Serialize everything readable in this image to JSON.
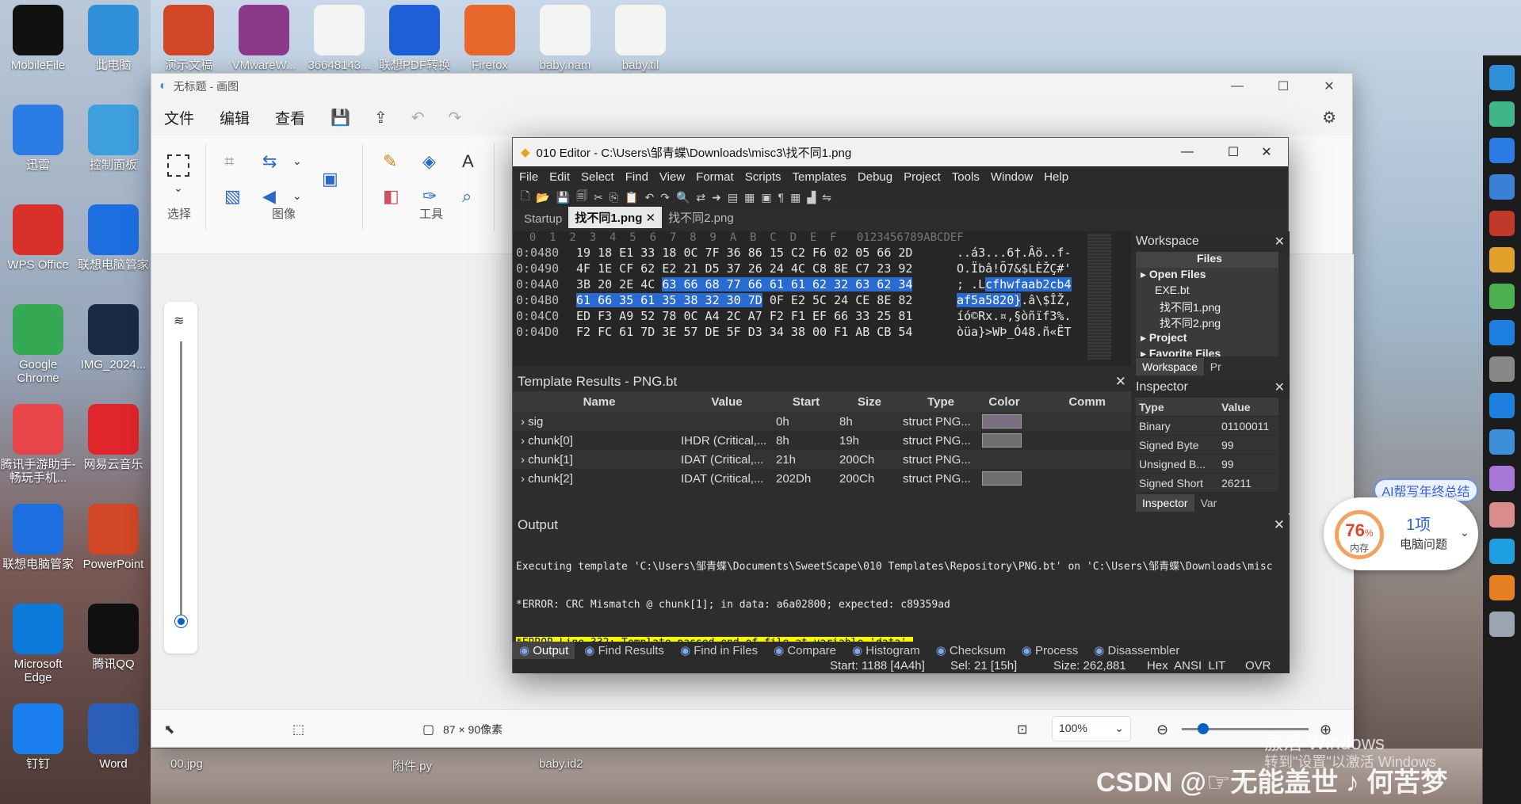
{
  "desktop": {
    "icons": [
      {
        "label": "MobileFile",
        "icon": "mobilefile-icon",
        "color": "#111111"
      },
      {
        "label": "此电脑",
        "icon": "computer-icon",
        "color": "#2f8fd8"
      },
      {
        "label": "演示文稿",
        "icon": "powerpoint-file-icon",
        "color": "#d24726"
      },
      {
        "label": "VMwareW...",
        "icon": "winrar-icon",
        "color": "#8b3a8b"
      },
      {
        "label": "36648143...",
        "icon": "document-icon",
        "color": "#f4f4f4"
      },
      {
        "label": "联想PDF转换",
        "icon": "pdf-icon",
        "color": "#1d5fd6"
      },
      {
        "label": "Firefox",
        "icon": "firefox-icon",
        "color": "#e8672a"
      },
      {
        "label": "baby.nam",
        "icon": "file-icon",
        "color": "#f4f4f4"
      },
      {
        "label": "baby.til",
        "icon": "file-icon",
        "color": "#f4f4f4"
      },
      {
        "label": "迅雷",
        "icon": "xunlei-icon",
        "color": "#2a7be4"
      },
      {
        "label": "控制面板",
        "icon": "control-panel-icon",
        "color": "#3fa0e0"
      },
      {
        "label": "WPS Office",
        "icon": "wps-icon",
        "color": "#d9302c"
      },
      {
        "label": "联想电脑管家",
        "icon": "lenovo-manager-icon",
        "color": "#1d6fe0"
      },
      {
        "label": "Google Chrome",
        "icon": "chrome-icon",
        "color": "#34a853"
      },
      {
        "label": "IMG_2024...",
        "icon": "image-icon",
        "color": "#1b2a44"
      },
      {
        "label": "腾讯手游助手-畅玩手机...",
        "icon": "tencent-game-icon",
        "color": "#e8454a"
      },
      {
        "label": "网易云音乐",
        "icon": "netease-music-icon",
        "color": "#e0262b"
      },
      {
        "label": "联想电脑管家",
        "icon": "lenovo-manager-icon",
        "color": "#1d6fe0"
      },
      {
        "label": "PowerPoint",
        "icon": "powerpoint-icon",
        "color": "#d24726"
      },
      {
        "label": "Microsoft Edge",
        "icon": "edge-icon",
        "color": "#0c7ad8"
      },
      {
        "label": "腾讯QQ",
        "icon": "qq-icon",
        "color": "#111111"
      },
      {
        "label": "钉钉",
        "icon": "dingtalk-icon",
        "color": "#1a7ef0"
      },
      {
        "label": "Word",
        "icon": "word-icon",
        "color": "#2b5fb8"
      }
    ],
    "bottom_labels": [
      "00.jpg",
      "附件.py",
      "baby.id2"
    ]
  },
  "paint": {
    "title": "无标题 - 画图",
    "menu": [
      "文件",
      "编辑",
      "查看"
    ],
    "groups": {
      "select": "选择",
      "image": "图像",
      "tools": "工具"
    },
    "status": {
      "size": "87 × 90像素",
      "zoom": "100%"
    }
  },
  "editor": {
    "title": "010 Editor - C:\\Users\\邹青蝶\\Downloads\\misc3\\找不同1.png",
    "menu": [
      "File",
      "Edit",
      "Select",
      "Find",
      "View",
      "Format",
      "Scripts",
      "Templates",
      "Debug",
      "Project",
      "Tools",
      "Window",
      "Help"
    ],
    "tabs": [
      "Startup",
      "找不同1.png",
      "找不同2.png"
    ],
    "hex_header": "  0  1  2  3  4  5  6  7  8  9  A  B  C  D  E  F   0123456789ABCDEF",
    "hex_rows": [
      {
        "addr": "0:0480",
        "pre": "19 18 E1 33 18 0C 7F 36 86 15 C2 F6 02 05 66 2D",
        "hl": "",
        "post": "",
        "asc_pre": "..á3...6†.Âö..f-",
        "asc_hl": "",
        "asc_post": ""
      },
      {
        "addr": "0:0490",
        "pre": "4F 1E CF 62 E2 21 D5 37 26 24 4C C8 8E C7 23 92",
        "hl": "",
        "post": "",
        "asc_pre": "O.Ïbâ!Õ7&$LÈŽÇ#'",
        "asc_hl": "",
        "asc_post": ""
      },
      {
        "addr": "0:04A0",
        "pre": "3B 20 2E 4C ",
        "hl": "63 66 68 77 66 61 61 62 32 63 62 34",
        "post": "",
        "asc_pre": "; .L",
        "asc_hl": "cfhwfaab2cb4",
        "asc_post": ""
      },
      {
        "addr": "0:04B0",
        "pre": "",
        "hl": "61 66 35 61 35 38 32 30 7D",
        "post": " 0F E2 5C 24 CE 8E 82",
        "asc_pre": "",
        "asc_hl": "af5a5820}",
        "asc_post": ".â\\$ÎŽ‚"
      },
      {
        "addr": "0:04C0",
        "pre": "ED F3 A9 52 78 0C A4 2C A7 F2 F1 EF 66 33 25 81",
        "hl": "",
        "post": "",
        "asc_pre": "íó©Rx.¤,§òñïf3%.",
        "asc_hl": "",
        "asc_post": ""
      },
      {
        "addr": "0:04D0",
        "pre": "F2 FC 61 7D 3E 57 DE 5F D3 34 38 00 F1 AB CB 54",
        "hl": "",
        "post": "",
        "asc_pre": "òüa}>WÞ_Ó48.ñ«ËT",
        "asc_hl": "",
        "asc_post": ""
      }
    ],
    "workspace": {
      "title": "Workspace",
      "files_header": "Files",
      "items": [
        "Open Files",
        "EXE.bt",
        "找不同1.png",
        "找不同2.png",
        "Project",
        "Favorite Files"
      ],
      "tabs": [
        "Workspace",
        "Pr"
      ]
    },
    "inspector": {
      "title": "Inspector",
      "headers": [
        "Type",
        "Value"
      ],
      "rows": [
        {
          "type": "Binary",
          "value": "01100011"
        },
        {
          "type": "Signed Byte",
          "value": "99"
        },
        {
          "type": "Unsigned B...",
          "value": "99"
        },
        {
          "type": "Signed Short",
          "value": "26211"
        }
      ],
      "tabs": [
        "Inspector",
        "Var"
      ]
    },
    "template": {
      "title": "Template Results - PNG.bt",
      "columns": [
        "Name",
        "Value",
        "Start",
        "Size",
        "Type",
        "Color",
        "Comm"
      ],
      "rows": [
        {
          "name": "sig",
          "value": "",
          "start": "0h",
          "size": "8h",
          "type": "struct PNG...",
          "color": "#7a6f7e"
        },
        {
          "name": "chunk[0]",
          "value": "IHDR  (Critical,...",
          "start": "8h",
          "size": "19h",
          "type": "struct PNG...",
          "color": "#6f6f70"
        },
        {
          "name": "chunk[1]",
          "value": "IDAT  (Critical,...",
          "start": "21h",
          "size": "200Ch",
          "type": "struct PNG...",
          "color": ""
        },
        {
          "name": "chunk[2]",
          "value": "IDAT  (Critical,...",
          "start": "202Dh",
          "size": "200Ch",
          "type": "struct PNG...",
          "color": "#6f6f70"
        }
      ]
    },
    "output": {
      "title": "Output",
      "lines": [
        "Executing template 'C:\\Users\\邹青蝶\\Documents\\SweetScape\\010 Templates\\Repository\\PNG.bt' on 'C:\\Users\\邹青蝶\\Downloads\\misc",
        "*ERROR: CRC Mismatch @ chunk[1]; in data: a6a02800; expected: c89359ad"
      ],
      "error_line": "*ERROR Line 332: Template passed end of file at variable 'data'."
    },
    "bottom_tabs": [
      "Output",
      "Find Results",
      "Find in Files",
      "Compare",
      "Histogram",
      "Checksum",
      "Process",
      "Disassembler"
    ],
    "status": {
      "start": "Start: 1188 [4A4h]",
      "sel": "Sel: 21 [15h]",
      "size": "Size: 262,881",
      "enc": "Hex  ANSI  LIT",
      "ovr": "OVR"
    }
  },
  "widget": {
    "memory_pct": "76",
    "pct_sign": "%",
    "memory_label": "内存",
    "issues": "1项",
    "issues_label": "电脑问题",
    "ai_pill": "AI帮写年终总结"
  },
  "watermarks": {
    "activate": "激活 Windows",
    "activate_sub": "转到\"设置\"以激活 Windows",
    "csdn": "CSDN @☞无能盖世 ♪ 何苦梦"
  }
}
